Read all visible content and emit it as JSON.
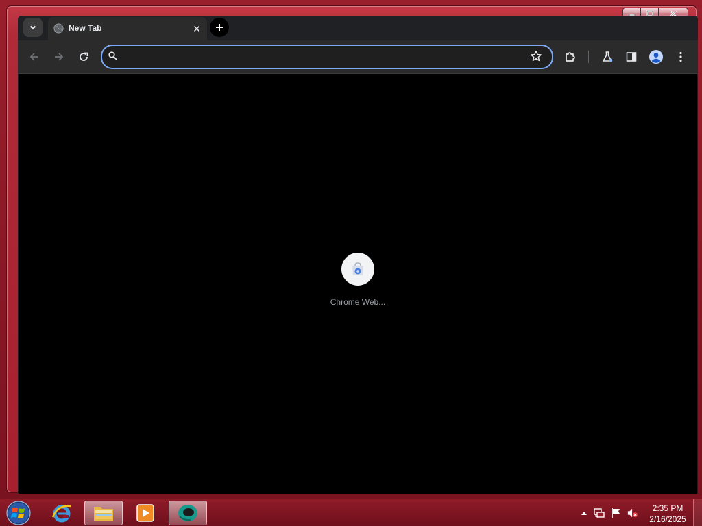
{
  "browser": {
    "tab": {
      "title": "New Tab",
      "favicon": "globe-icon"
    },
    "omnibox": {
      "value": "",
      "placeholder": ""
    },
    "toolbar_icons": [
      "back-icon",
      "forward-icon",
      "reload-icon",
      "search-icon",
      "bookmark-star-icon",
      "extensions-icon",
      "labs-flask-icon",
      "side-panel-icon",
      "profile-icon",
      "menu-kebab-icon"
    ],
    "accent_color": "#7ca9f5"
  },
  "new_tab_page": {
    "shortcut": {
      "label": "Chrome Web...",
      "icon": "chrome-web-store-icon"
    }
  },
  "window_controls": [
    "minimize-icon",
    "maximize-icon",
    "close-icon"
  ],
  "taskbar": {
    "start": "windows-start-icon",
    "apps": [
      "internet-explorer-icon",
      "file-explorer-icon",
      "media-player-icon",
      "chrome-app-icon"
    ],
    "tray_icons": [
      "show-hidden-icons-icon",
      "network-icon",
      "action-center-flag-icon",
      "volume-muted-icon"
    ],
    "clock": {
      "time": "2:35 PM",
      "date": "2/16/2025"
    }
  }
}
